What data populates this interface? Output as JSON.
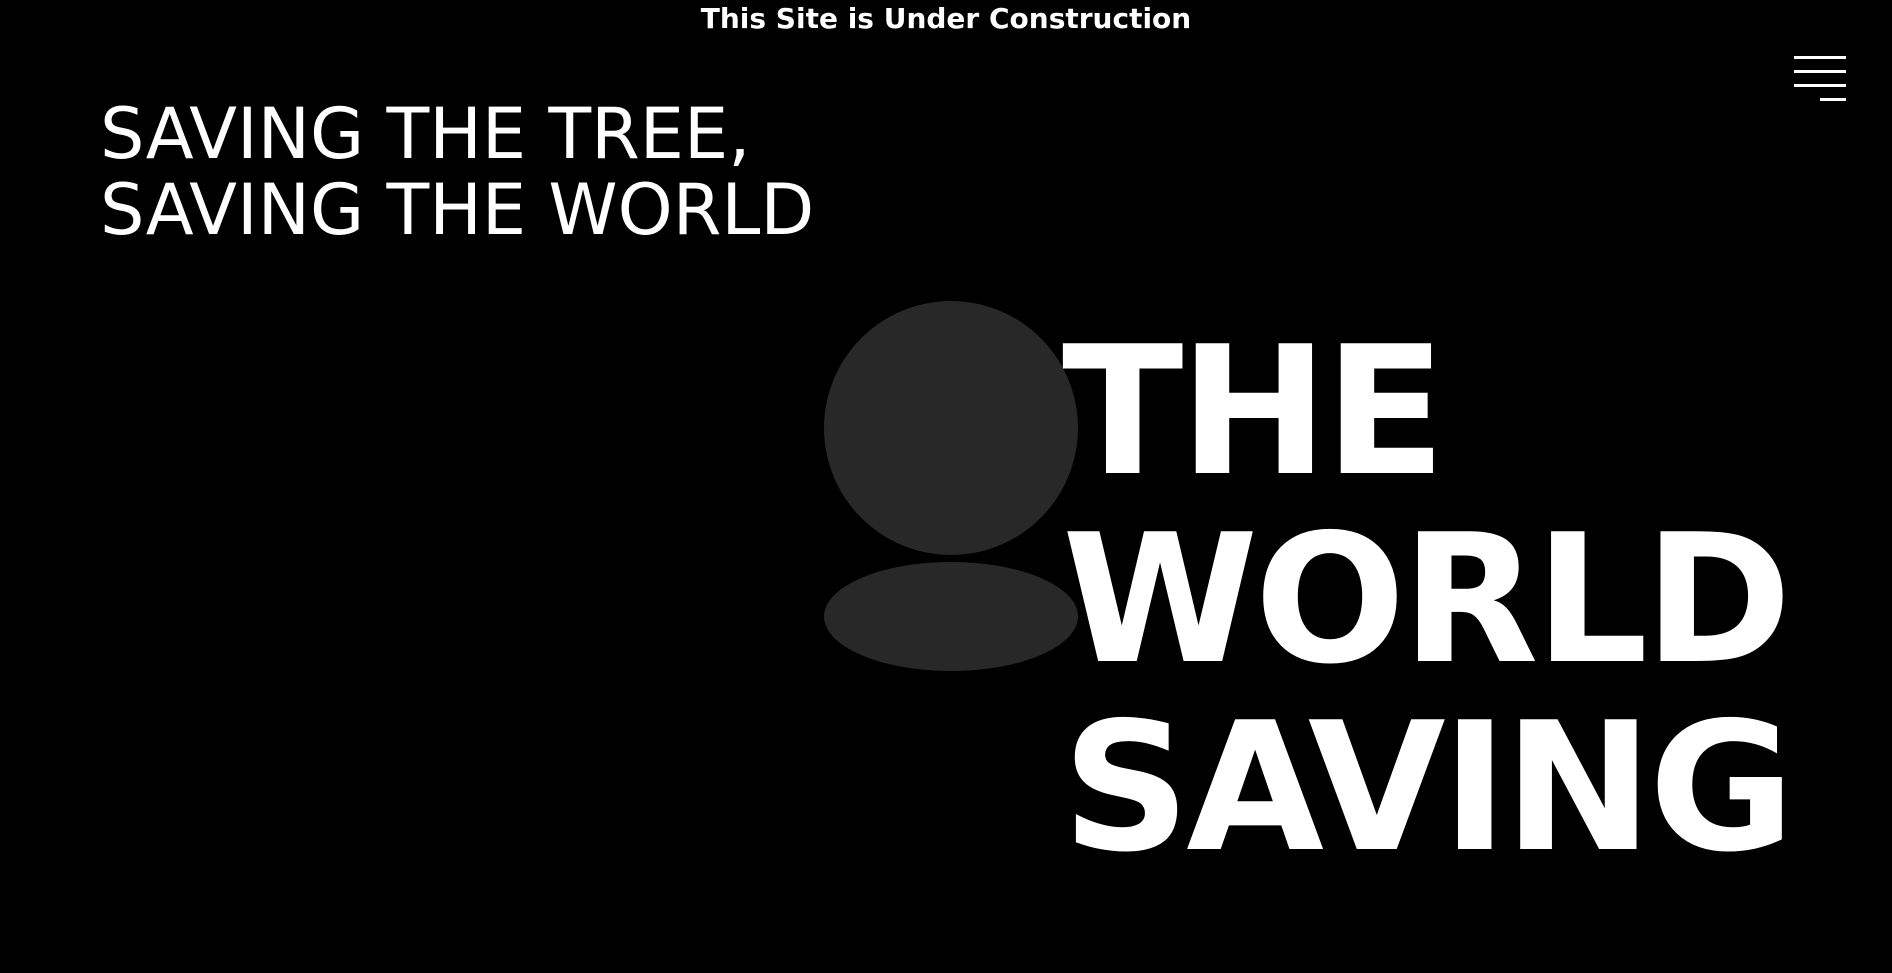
{
  "banner": {
    "text": "This Site is Under Construction"
  },
  "menu": {
    "icon": "hamburger-menu-icon"
  },
  "tagline": {
    "line1": "SAVING THE TREE,",
    "line2": "SAVING THE WORLD"
  },
  "avatar": {
    "icon": "user-placeholder-icon",
    "color": "#282828"
  },
  "hero": {
    "line1": "THE",
    "line2": "WORLD",
    "line3": "SAVING"
  },
  "colors": {
    "background": "#000000",
    "text": "#ffffff"
  }
}
